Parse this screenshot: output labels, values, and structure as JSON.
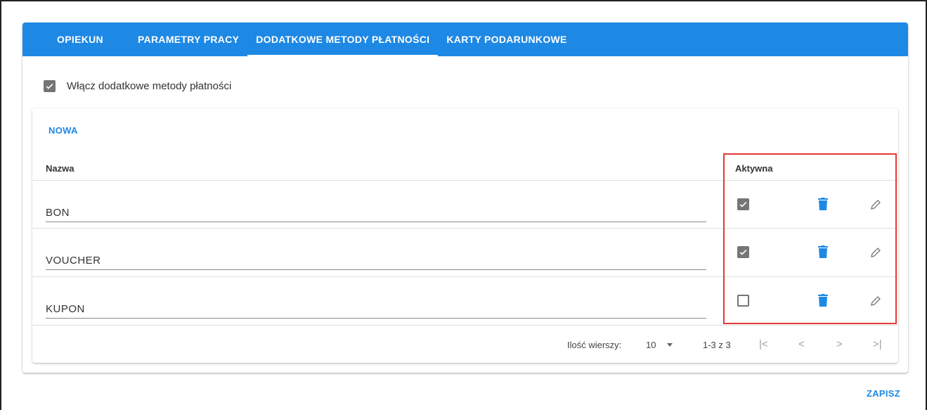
{
  "tabs": [
    {
      "label": "OPIEKUN"
    },
    {
      "label": "PARAMETRY PRACY"
    },
    {
      "label": "DODATKOWE METODY PŁATNOŚCI"
    },
    {
      "label": "KARTY PODARUNKOWE"
    }
  ],
  "active_tab": "DODATKOWE METODY PŁATNOŚCI",
  "enable_methods": {
    "label": "Włącz dodatkowe metody płatności",
    "checked": true
  },
  "new_button": "NOWA",
  "table": {
    "columns": {
      "name": "Nazwa",
      "active": "Aktywna"
    },
    "rows": [
      {
        "name": "BON",
        "active": true
      },
      {
        "name": "VOUCHER",
        "active": true
      },
      {
        "name": "KUPON",
        "active": false
      }
    ]
  },
  "pagination": {
    "rows_per_page_label": "Ilość wierszy:",
    "rows_per_page": "10",
    "range": "1-3 z 3",
    "first_icon": "first-page-icon",
    "prev_icon": "chevron-left-icon",
    "next_icon": "chevron-right-icon",
    "last_icon": "last-page-icon"
  },
  "save_button": "ZAPISZ",
  "colors": {
    "accent": "#1e88e5",
    "highlight": "#e53935"
  }
}
